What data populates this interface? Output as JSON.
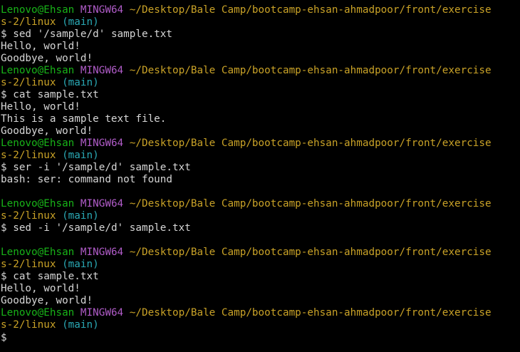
{
  "terminal": {
    "prompt": {
      "user_host": "Lenovo@Ehsan",
      "system": "MINGW64",
      "path_line1": "~/Desktop/Bale Camp/bootcamp-ehsan-ahmadpoor/front/exercise",
      "path_line2": "s-2/linux",
      "branch": "(main)",
      "symbol": "$"
    },
    "blocks": [
      {
        "command": "sed '/sample/d' sample.txt",
        "output": [
          "Hello, world!",
          "Goodbye, world!"
        ]
      },
      {
        "command": "cat sample.txt",
        "output": [
          "Hello, world!",
          "This is a sample text file.",
          "Goodbye, world!"
        ]
      },
      {
        "command": "ser -i '/sample/d' sample.txt",
        "output": [
          "bash: ser: command not found",
          ""
        ]
      },
      {
        "command": "sed -i '/sample/d' sample.txt",
        "output": [
          ""
        ]
      },
      {
        "command": "cat sample.txt",
        "output": [
          "Hello, world!",
          "Goodbye, world!"
        ]
      },
      {
        "command": "",
        "output": []
      }
    ]
  },
  "colors": {
    "background": "#000000",
    "user": "#18b218",
    "system": "#b05cc8",
    "path": "#c9a227",
    "branch": "#2aa9b5",
    "text": "#d6d6d6"
  }
}
